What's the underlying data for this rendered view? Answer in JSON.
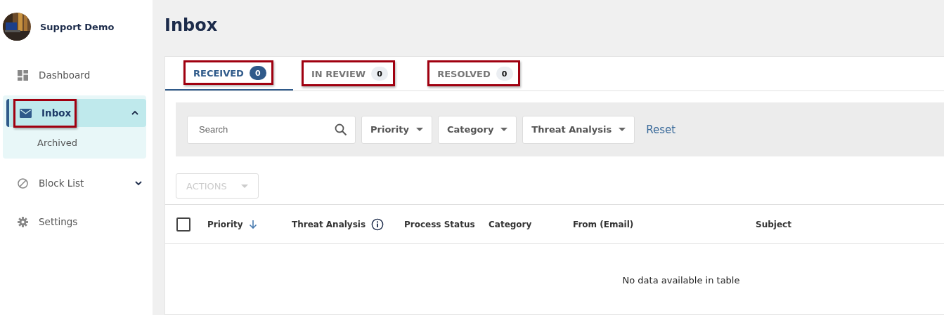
{
  "account": {
    "name": "Support Demo"
  },
  "sidebar": {
    "items": [
      {
        "label": "Dashboard",
        "selected": false,
        "highlighted": false
      },
      {
        "label": "Inbox",
        "selected": true,
        "expanded": true,
        "highlighted": true,
        "children": [
          {
            "label": "Archived",
            "selected": false
          }
        ]
      },
      {
        "label": "Block List",
        "selected": false,
        "expanded": false,
        "highlighted": false
      },
      {
        "label": "Settings",
        "selected": false,
        "highlighted": false
      }
    ]
  },
  "page_title": "Inbox",
  "tabs": [
    {
      "label": "RECEIVED",
      "count": "0",
      "selected": true,
      "highlighted": true
    },
    {
      "label": "IN REVIEW",
      "count": "0",
      "selected": false,
      "highlighted": true
    },
    {
      "label": "RESOLVED",
      "count": "0",
      "selected": false,
      "highlighted": true
    }
  ],
  "filters": {
    "search": {
      "placeholder": "Search"
    },
    "dropdowns": [
      "Priority",
      "Category",
      "Threat Analysis"
    ],
    "reset": "Reset"
  },
  "actions": {
    "label": "ACTIONS",
    "disabled": true
  },
  "table": {
    "select_all": {
      "checked": false
    },
    "columns": [
      {
        "label": "Priority",
        "sorted": true,
        "info": false
      },
      {
        "label": "Threat Analysis",
        "sorted": false,
        "info": true
      },
      {
        "label": "Process Status",
        "sorted": false,
        "info": false
      },
      {
        "label": "Category",
        "sorted": false,
        "info": false
      },
      {
        "label": "From (Email)",
        "sorted": false,
        "info": false
      },
      {
        "label": "Subject",
        "sorted": false,
        "info": false
      }
    ],
    "empty_message": "No data available in table"
  }
}
